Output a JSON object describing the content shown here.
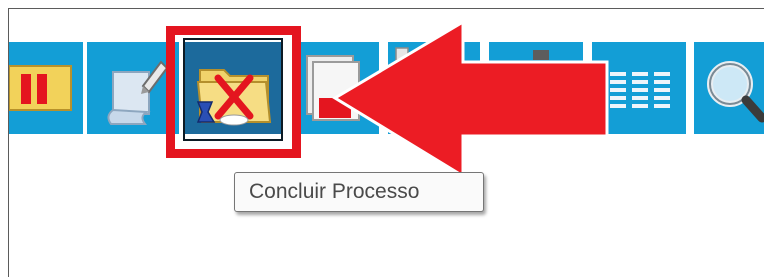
{
  "toolbar": {
    "buttons": [
      {
        "name": "pause-button",
        "icon": "pause-folder-icon"
      },
      {
        "name": "edit-button",
        "icon": "edit-document-icon"
      },
      {
        "name": "conclude-process-button",
        "icon": "folder-cross-icon",
        "state": "pressed",
        "highlighted": true
      },
      {
        "name": "document-button",
        "icon": "document-stack-icon"
      },
      {
        "name": "toolbar-button-5",
        "icon": "generic-icon"
      },
      {
        "name": "toolbar-button-6",
        "icon": "generic-icon"
      },
      {
        "name": "list-button",
        "icon": "list-columns-icon"
      },
      {
        "name": "search-button",
        "icon": "magnifier-icon"
      }
    ]
  },
  "tooltip": {
    "text": "Concluir Processo"
  },
  "annotation": {
    "arrow_color": "#e4151f",
    "highlight_color": "#e4151f"
  },
  "colors": {
    "button_bg": "#139ed6",
    "button_pressed_bg": "#1c6a9c",
    "accent": "#e4151f"
  }
}
